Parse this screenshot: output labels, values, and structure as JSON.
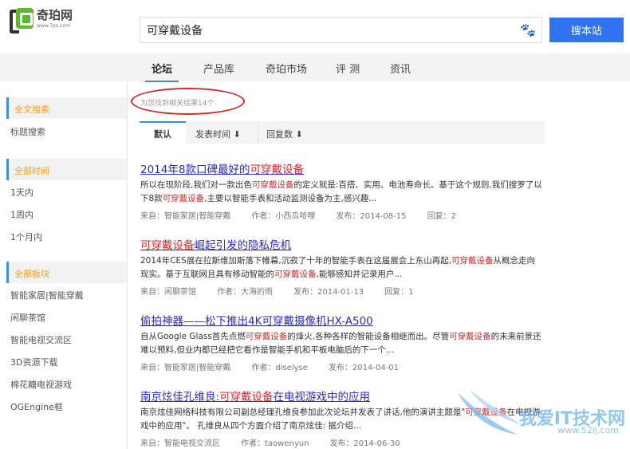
{
  "logo": {
    "name": "奇珀网",
    "url": "www.7po.com"
  },
  "search": {
    "value": "可穿戴设备",
    "button": "搜本站"
  },
  "nav": [
    "论坛",
    "产品库",
    "奇珀市场",
    "评 测",
    "资讯"
  ],
  "sidebar": {
    "groups": [
      {
        "head": "全文搜索",
        "items": [
          "标题搜索"
        ]
      },
      {
        "head": "全部时间",
        "items": [
          "1天内",
          "1周内",
          "1个月内"
        ]
      },
      {
        "head": "全部板块",
        "items": [
          "智能家居|智能穿戴",
          "闲聊茶馆",
          "智能电视交流区",
          "3D资源下载",
          "棉花糖电视游戏",
          "OGEngine框"
        ]
      }
    ]
  },
  "count_text": "为您找到相关结果14个",
  "sort": [
    "默认",
    "发表时间 ⬇",
    "回复数 ⬇"
  ],
  "results": [
    {
      "title": [
        {
          "t": "2014年8款口碑最好的",
          "hl": false
        },
        {
          "t": "可穿戴设备",
          "hl": true
        }
      ],
      "snippet": [
        {
          "t": "所以在现阶段,我们对一款出色",
          "hl": false
        },
        {
          "t": "可穿戴设备",
          "hl": true
        },
        {
          "t": "的定义就是:百搭、实用、电池寿命长。基于这个规则,我们搜罗了以下8款",
          "hl": false
        },
        {
          "t": "可穿戴设备",
          "hl": true
        },
        {
          "t": ",主要以智能手表和活动监测设备为主,感兴趣...",
          "hl": false
        }
      ],
      "meta": [
        "来自：智能家居|智能穿戴",
        "作者：小西瓜哈哩",
        "发布：2014-08-15",
        "回复：2"
      ]
    },
    {
      "title": [
        {
          "t": "可穿戴设备",
          "hl": true
        },
        {
          "t": "崛起引发的隐私危机",
          "hl": false
        }
      ],
      "snippet": [
        {
          "t": "2014年CES展在拉斯维加斯落下帷幕,沉寂了十年的智能手表在这届展会上东山再起,",
          "hl": false
        },
        {
          "t": "可穿戴设备",
          "hl": true
        },
        {
          "t": "从概念走向现实。基于互联网且具有移动智能的",
          "hl": false
        },
        {
          "t": "可穿戴设备",
          "hl": true
        },
        {
          "t": ",能够感知并记录用户...",
          "hl": false
        }
      ],
      "meta": [
        "来自：闲聊茶馆",
        "作者：大海的雨",
        "发布：2014-01-13",
        "回复：1"
      ]
    },
    {
      "title": [
        {
          "t": "偷拍神器——松下推出4K可穿戴摄像机HX-A500",
          "hl": false
        }
      ],
      "snippet": [
        {
          "t": "自从Google Glass首先点燃",
          "hl": false
        },
        {
          "t": "可穿戴设备",
          "hl": true
        },
        {
          "t": "的烽火,各种各样的智能设备相继而出。尽管",
          "hl": false
        },
        {
          "t": "可穿戴设备",
          "hl": true
        },
        {
          "t": "的未来前景还难以预料,但业内都已经把它看作是智能手机和平板电脑后的下一个...",
          "hl": false
        }
      ],
      "meta": [
        "来自：智能家居|智能穿戴",
        "作者：diselyse",
        "发布：2014-04-01"
      ]
    },
    {
      "title": [
        {
          "t": "南京炫佳孔维良:",
          "hl": false
        },
        {
          "t": "可穿戴设备",
          "hl": true
        },
        {
          "t": "在电视游戏中的应用",
          "hl": false
        }
      ],
      "snippet": [
        {
          "t": "南京炫佳网络科技有限公司副总经理孔维良参加此次论坛并发表了讲话,他的演讲主题是\"",
          "hl": false
        },
        {
          "t": "可穿戴设备",
          "hl": true
        },
        {
          "t": "在电视游戏中的应用\"。 孔维良从四个方面介绍了南京炫佳: 据介绍...",
          "hl": false
        }
      ],
      "meta": [
        "来自：智能电视交流区",
        "作者：taowenyun",
        "发布：2014-06-30"
      ]
    }
  ],
  "watermark": {
    "text": "我爱IT技术网",
    "url": "www.52ij.com"
  }
}
